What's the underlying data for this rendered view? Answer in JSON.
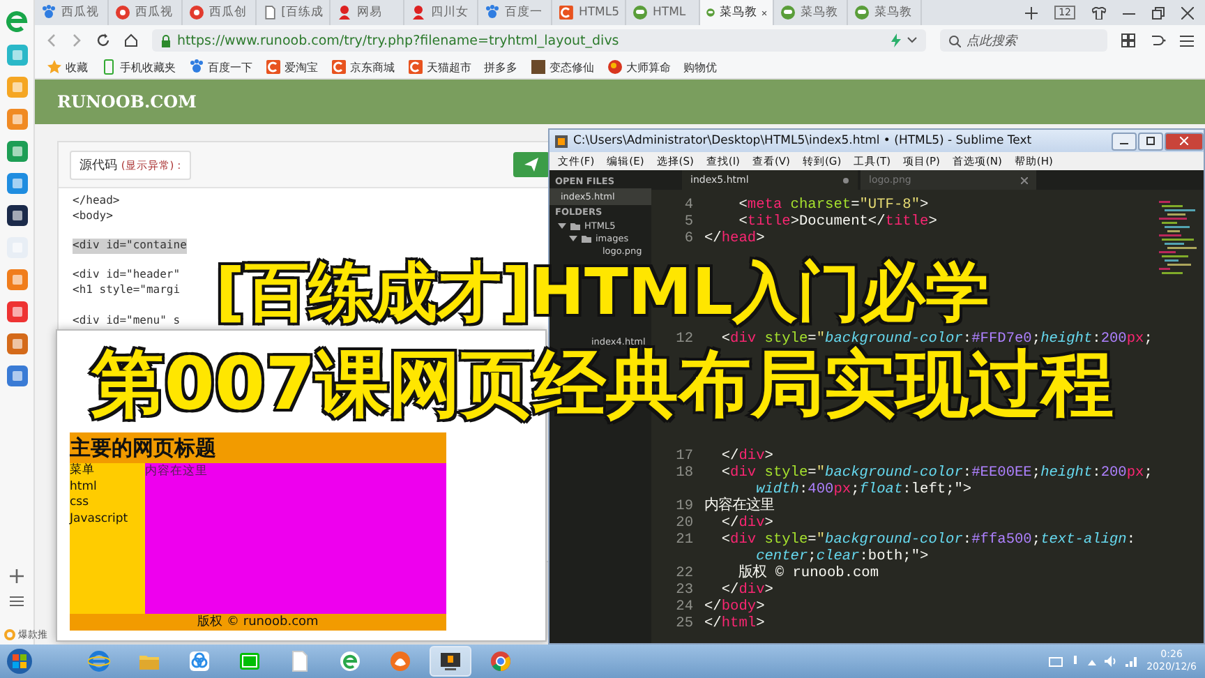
{
  "browser": {
    "tabs": [
      {
        "label": "西瓜视",
        "kind": "paw",
        "selected": false
      },
      {
        "label": "西瓜视",
        "kind": "pin",
        "selected": false
      },
      {
        "label": "西瓜创",
        "kind": "pin",
        "selected": false
      },
      {
        "label": "[百练成",
        "kind": "page",
        "selected": false
      },
      {
        "label": "网易",
        "kind": "person",
        "selected": false
      },
      {
        "label": "四川女",
        "kind": "person",
        "selected": false
      },
      {
        "label": "百度一",
        "kind": "paw",
        "selected": false
      },
      {
        "label": "HTML5",
        "kind": "square",
        "selected": false
      },
      {
        "label": "HTML",
        "kind": "face",
        "selected": false
      },
      {
        "label": "菜鸟教",
        "kind": "face",
        "selected": true
      },
      {
        "label": "菜鸟教",
        "kind": "face",
        "selected": false
      },
      {
        "label": "菜鸟教",
        "kind": "face",
        "selected": false
      }
    ],
    "tab_count": "12",
    "url": "https://www.runoob.com/try/try.php?filename=tryhtml_layout_divs",
    "search": {
      "placeholder": "点此搜索"
    },
    "bookmarks": [
      {
        "label": "收藏",
        "kind": "star"
      },
      {
        "label": "手机收藏夹",
        "kind": "phone"
      },
      {
        "label": "百度一下",
        "kind": "paw"
      },
      {
        "label": "爱淘宝",
        "kind": "square"
      },
      {
        "label": "京东商城",
        "kind": "square"
      },
      {
        "label": "天猫超市",
        "kind": "square"
      },
      {
        "label": "拼多多",
        "kind": "plain"
      },
      {
        "label": "变态修仙",
        "kind": "tile"
      },
      {
        "label": "大师算命",
        "kind": "ball"
      },
      {
        "label": "购物优",
        "kind": "plain"
      }
    ],
    "site_logo": "RUNOOB.COM",
    "source_button": {
      "label": "源代码",
      "note": "(显示异常) :"
    },
    "code_lines": [
      {
        "kind": "code",
        "text": "</head>",
        "selected": false
      },
      {
        "kind": "code",
        "text": "<body>",
        "selected": false
      },
      {
        "kind": "blank",
        "selected": false
      },
      {
        "kind": "code",
        "text": "<div id=\"containe",
        "selected": true
      },
      {
        "kind": "blank",
        "selected": false
      },
      {
        "kind": "code",
        "text": "<div id=\"header\"",
        "selected": false
      },
      {
        "kind": "code",
        "text": "<h1 style=\"margi",
        "selected": false
      },
      {
        "kind": "blank",
        "selected": false
      },
      {
        "kind": "code",
        "text": "<div id=\"menu\" s",
        "selected": false
      }
    ],
    "promo": "爆款推"
  },
  "result_window": {
    "heading": "主要的网页标题",
    "menu": [
      "菜单",
      "html",
      "css",
      "Javascript"
    ],
    "content": "内容在这里",
    "footer": "版权 © runoob.com"
  },
  "editor": {
    "title": "C:\\Users\\Administrator\\Desktop\\HTML5\\index5.html • (HTML5) - Sublime Text",
    "menu": [
      "文件(F)",
      "编辑(E)",
      "选择(S)",
      "查找(I)",
      "查看(V)",
      "转到(G)",
      "工具(T)",
      "项目(P)",
      "首选项(N)",
      "帮助(H)"
    ],
    "open_files_label": "OPEN FILES",
    "open_files": [
      "index5.html"
    ],
    "folders_label": "FOLDERS",
    "tree": [
      {
        "label": "HTML5",
        "expanded": true,
        "children": [
          {
            "label": "images",
            "expanded": true,
            "children": [
              {
                "label": "logo.png"
              }
            ]
          },
          {
            "label": "index4.html"
          }
        ]
      }
    ],
    "tabs": [
      {
        "label": "index5.html",
        "selected": true
      },
      {
        "label": "logo.png",
        "selected": false
      }
    ],
    "lines": [
      {
        "kind": "code",
        "number": "4",
        "tokens": [
          {
            "kind": "punct",
            "text": "    <"
          },
          {
            "kind": "tag",
            "text": "meta"
          },
          {
            "kind": "attr",
            "text": " charset"
          },
          {
            "kind": "punct",
            "text": "="
          },
          {
            "kind": "string",
            "text": "\"UTF-8\""
          },
          {
            "kind": "punct",
            "text": ">"
          }
        ]
      },
      {
        "kind": "code",
        "number": "5",
        "tokens": [
          {
            "kind": "punct",
            "text": "    <"
          },
          {
            "kind": "tag",
            "text": "title"
          },
          {
            "kind": "punct",
            "text": ">Document</"
          },
          {
            "kind": "tag",
            "text": "title"
          },
          {
            "kind": "punct",
            "text": ">"
          }
        ]
      },
      {
        "kind": "code",
        "number": "6",
        "tokens": [
          {
            "kind": "punct",
            "text": "</"
          },
          {
            "kind": "tag",
            "text": "head"
          },
          {
            "kind": "punct",
            "text": ">"
          }
        ]
      },
      {
        "kind": "covered"
      },
      {
        "kind": "covered"
      },
      {
        "kind": "covered"
      },
      {
        "kind": "covered"
      },
      {
        "kind": "covered"
      },
      {
        "kind": "code",
        "number": "12",
        "tokens": [
          {
            "kind": "punct",
            "text": "  <"
          },
          {
            "kind": "tag",
            "text": "div"
          },
          {
            "kind": "attr",
            "text": " style"
          },
          {
            "kind": "punct",
            "text": "="
          },
          {
            "kind": "string",
            "text": "\""
          },
          {
            "kind": "prop",
            "text": "background-color"
          },
          {
            "kind": "punct",
            "text": ":"
          },
          {
            "kind": "number",
            "text": "#FFD7e0"
          },
          {
            "kind": "punct",
            "text": ";"
          },
          {
            "kind": "prop",
            "text": "height"
          },
          {
            "kind": "punct",
            "text": ":"
          },
          {
            "kind": "number",
            "text": "200"
          },
          {
            "kind": "unit",
            "text": "px"
          },
          {
            "kind": "punct",
            "text": ";"
          }
        ]
      },
      {
        "kind": "covered"
      },
      {
        "kind": "covered"
      },
      {
        "kind": "covered"
      },
      {
        "kind": "covered"
      },
      {
        "kind": "covered"
      },
      {
        "kind": "covered"
      },
      {
        "kind": "code",
        "number": "17",
        "tokens": [
          {
            "kind": "punct",
            "text": "  </"
          },
          {
            "kind": "tag",
            "text": "div"
          },
          {
            "kind": "punct",
            "text": ">"
          }
        ]
      },
      {
        "kind": "code",
        "number": "18",
        "tokens": [
          {
            "kind": "punct",
            "text": "  <"
          },
          {
            "kind": "tag",
            "text": "div"
          },
          {
            "kind": "attr",
            "text": " style"
          },
          {
            "kind": "punct",
            "text": "="
          },
          {
            "kind": "string",
            "text": "\""
          },
          {
            "kind": "prop",
            "text": "background-color"
          },
          {
            "kind": "punct",
            "text": ":"
          },
          {
            "kind": "number",
            "text": "#EE00EE"
          },
          {
            "kind": "punct",
            "text": ";"
          },
          {
            "kind": "prop",
            "text": "height"
          },
          {
            "kind": "punct",
            "text": ":"
          },
          {
            "kind": "number",
            "text": "200"
          },
          {
            "kind": "unit",
            "text": "px"
          },
          {
            "kind": "punct",
            "text": ";"
          }
        ]
      },
      {
        "kind": "wrap",
        "tokens": [
          {
            "kind": "prop",
            "text": "      width"
          },
          {
            "kind": "punct",
            "text": ":"
          },
          {
            "kind": "number",
            "text": "400"
          },
          {
            "kind": "unit",
            "text": "px"
          },
          {
            "kind": "punct",
            "text": ";"
          },
          {
            "kind": "prop",
            "text": "float"
          },
          {
            "kind": "punct",
            "text": ":left;\">"
          }
        ]
      },
      {
        "kind": "code",
        "number": "19",
        "tokens": [
          {
            "kind": "punct",
            "text": "内容在这里"
          }
        ]
      },
      {
        "kind": "code",
        "number": "20",
        "tokens": [
          {
            "kind": "punct",
            "text": "  </"
          },
          {
            "kind": "tag",
            "text": "div"
          },
          {
            "kind": "punct",
            "text": ">"
          }
        ]
      },
      {
        "kind": "code",
        "number": "21",
        "tokens": [
          {
            "kind": "punct",
            "text": "  <"
          },
          {
            "kind": "tag",
            "text": "div"
          },
          {
            "kind": "attr",
            "text": " style"
          },
          {
            "kind": "punct",
            "text": "="
          },
          {
            "kind": "string",
            "text": "\""
          },
          {
            "kind": "prop",
            "text": "background-color"
          },
          {
            "kind": "punct",
            "text": ":"
          },
          {
            "kind": "number",
            "text": "#ffa500"
          },
          {
            "kind": "punct",
            "text": ";"
          },
          {
            "kind": "prop",
            "text": "text-align"
          },
          {
            "kind": "punct",
            "text": ":"
          }
        ]
      },
      {
        "kind": "wrap",
        "tokens": [
          {
            "kind": "prop",
            "text": "      center"
          },
          {
            "kind": "punct",
            "text": ";"
          },
          {
            "kind": "prop",
            "text": "clear"
          },
          {
            "kind": "punct",
            "text": ":both;\">"
          }
        ]
      },
      {
        "kind": "code",
        "number": "22",
        "tokens": [
          {
            "kind": "punct",
            "text": "    版权 © runoob.com"
          }
        ]
      },
      {
        "kind": "code",
        "number": "23",
        "tokens": [
          {
            "kind": "punct",
            "text": "  </"
          },
          {
            "kind": "tag",
            "text": "div"
          },
          {
            "kind": "punct",
            "text": ">"
          }
        ]
      },
      {
        "kind": "code",
        "number": "24",
        "tokens": [
          {
            "kind": "punct",
            "text": "</"
          },
          {
            "kind": "tag",
            "text": "body"
          },
          {
            "kind": "punct",
            "text": ">"
          }
        ]
      },
      {
        "kind": "code",
        "number": "25",
        "tokens": [
          {
            "kind": "punct",
            "text": "</"
          },
          {
            "kind": "tag",
            "text": "html"
          },
          {
            "kind": "punct",
            "text": ">"
          }
        ]
      }
    ]
  },
  "overlay_title": [
    "[百练成才]HTML入门必学",
    "第007课网页经典布局实现过程"
  ],
  "taskbar": {
    "apps": [
      {
        "kind": "ie",
        "selected": false
      },
      {
        "kind": "folder",
        "selected": false
      },
      {
        "kind": "cloud",
        "selected": false
      },
      {
        "kind": "tv",
        "selected": false
      },
      {
        "kind": "file",
        "selected": false
      },
      {
        "kind": "e360",
        "selected": false
      },
      {
        "kind": "fox",
        "selected": false
      },
      {
        "kind": "editor",
        "selected": true
      },
      {
        "kind": "chrome",
        "selected": false
      }
    ],
    "time": "0:26",
    "date": "2020/12/6"
  }
}
